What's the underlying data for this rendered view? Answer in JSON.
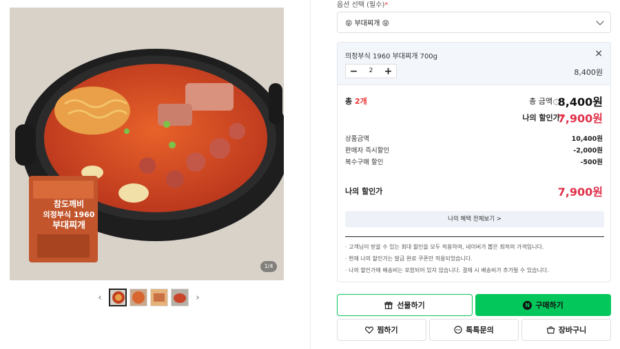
{
  "gallery": {
    "counter": "1/4",
    "package_lines": [
      "참도깨비",
      "의정부식 1960",
      "부대찌개"
    ],
    "thumbnails": [
      "thumb-1",
      "thumb-2",
      "thumb-3",
      "thumb-4"
    ],
    "prev_icon": "chevron-left-icon",
    "next_icon": "chevron-right-icon"
  },
  "option": {
    "label": "옵션 선택 (필수)",
    "required_mark": "*",
    "selected": "😝 부대찌개 😝"
  },
  "selected_item": {
    "name": "의정부식 1960 부대찌개 700g",
    "quantity": "2",
    "price": "8,400원",
    "minus": "−",
    "plus": "+",
    "close": "×"
  },
  "summary": {
    "total_qty_prefix": "총 ",
    "total_qty": "2개",
    "total_label": "총 금액",
    "info": "i",
    "total_price": "8,400원",
    "discount_label": "나의 할인가",
    "discount_caret": "^",
    "discount_price": "7,900원",
    "breakdown": [
      {
        "label": "상품금액",
        "value": "10,400원"
      },
      {
        "label": "판매자 즉시할인",
        "value": "-2,000원"
      },
      {
        "label": "복수구매 할인",
        "value": "-500원"
      }
    ],
    "my_price_label": "나의 할인가",
    "my_price": "7,900원",
    "benefit_button": "나의 혜택 전체보기 >",
    "notes": [
      "· 고객님이 받을 수 있는 최대 할인을 모두 적용하여, 네이버가 뽑은 최적의 가격입니다.",
      "· 현재 나의 할인가는 발급 완료 쿠폰만 적용되었습니다.",
      "· 나의 할인가에 배송비는 포함되어 있지 않습니다. 결제 시 배송비가 추가될 수 있습니다."
    ]
  },
  "actions": {
    "gift": "선물하기",
    "buy": "구매하기",
    "buy_badge": "N",
    "wish": "찜하기",
    "talk": "톡톡문의",
    "cart": "장바구니"
  },
  "colors": {
    "brand_green": "#03c75a",
    "discount_red": "#e0314a"
  }
}
